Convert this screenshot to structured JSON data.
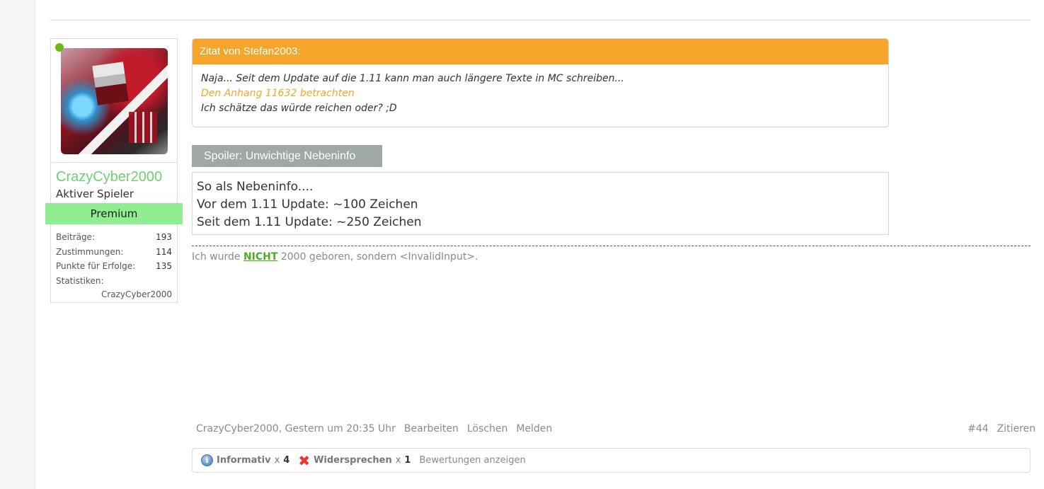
{
  "user": {
    "name": "CrazyCyber2000",
    "title": "Aktiver Spieler",
    "banner": "Premium",
    "stats": [
      {
        "label": "Beiträge:",
        "value": "193"
      },
      {
        "label": "Zustimmungen:",
        "value": "114"
      },
      {
        "label": "Punkte für Erfolge:",
        "value": "135"
      },
      {
        "label": "Statistiken:",
        "value": ""
      }
    ],
    "stats_extra": "CrazyCyber2000",
    "online_color": "#6bb81a"
  },
  "quote": {
    "header": "Zitat von Stefan2003:",
    "line1": "Naja... Seit dem Update auf die 1.11 kann man auch längere Texte in MC schreiben...",
    "attachment_link": "Den Anhang 11632 betrachten",
    "line3": "Ich schätze das würde reichen oder? ;D",
    "accent_color": "#f4a62a"
  },
  "spoiler": {
    "button_label": "Spoiler: Unwichtige Nebeninfo",
    "lines": [
      "So als Nebeninfo....",
      "Vor dem 1.11 Update: ~100 Zeichen",
      "Seit dem 1.11 Update: ~250 Zeichen"
    ]
  },
  "signature": {
    "before": "Ich wurde ",
    "strong": "NICHT",
    "after": " 2000 geboren, sondern <InvalidInput>."
  },
  "footer": {
    "author_date": "CrazyCyber2000, Gestern um 20:35 Uhr",
    "edit": "Bearbeiten",
    "delete": "Löschen",
    "report": "Melden",
    "post_number": "#44",
    "quote": "Zitieren"
  },
  "ratings": {
    "items": [
      {
        "label": "Informativ",
        "x": "x",
        "count": "4",
        "icon": "info-icon"
      },
      {
        "label": "Widersprechen",
        "x": "x",
        "count": "1",
        "icon": "x-icon"
      }
    ],
    "show_all": "Bewertungen anzeigen"
  }
}
